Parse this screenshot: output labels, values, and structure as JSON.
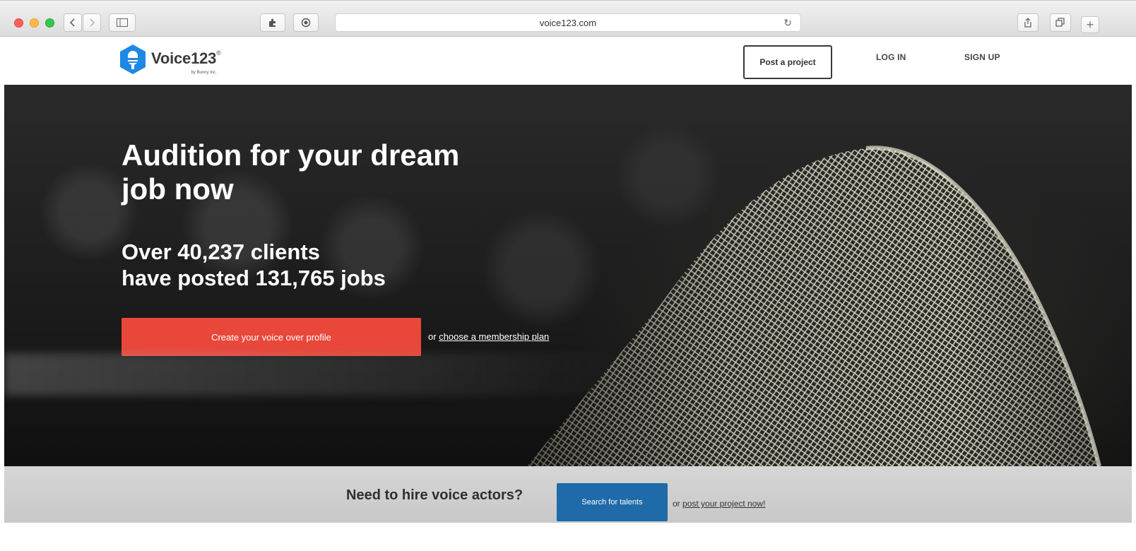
{
  "browser": {
    "url": "voice123.com"
  },
  "header": {
    "logo_title": "Voice123",
    "logo_sub": "by Bunny Inc.",
    "post_button": "Post a project",
    "login": "LOG IN",
    "signup": "SIGN UP"
  },
  "hero": {
    "title_line1": "Audition for your dream",
    "title_line2": "job now",
    "stats_line1": "Over 40,237 clients",
    "stats_line2": "have posted 131,765 jobs",
    "cta_label": "Create your voice over profile",
    "secondary_prefix": "or",
    "secondary_link": "choose a membership plan"
  },
  "band": {
    "question": "Need to hire voice actors?",
    "button": "Search for talents",
    "link_prefix": "or",
    "link": "post your project now!"
  },
  "colors": {
    "cta_red": "#e8473a",
    "band_blue": "#1f6aa8",
    "logo_blue": "#1e88e5"
  }
}
